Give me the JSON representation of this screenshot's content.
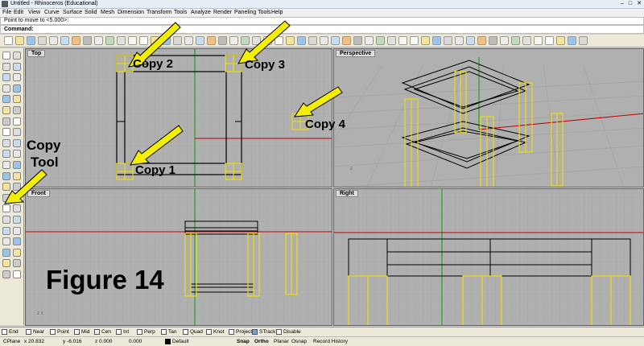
{
  "window": {
    "title": "Untitled - Rhinoceros (Educational)",
    "min": "–",
    "max": "□",
    "close": "✕"
  },
  "menu": [
    "File",
    "Edit",
    "View",
    "Curve",
    "Surface",
    "Solid",
    "Mesh",
    "Dimension",
    "Transform",
    "Tools",
    "Analyze",
    "Render",
    "Paneling Tools",
    "Help"
  ],
  "command_history": "Point to move to <5.000>:",
  "command_prompt": "Command:",
  "viewports": {
    "top": "Top",
    "perspective": "Perspective",
    "front": "Front",
    "right": "Right"
  },
  "annotations": {
    "copy1": "Copy 1",
    "copy2": "Copy 2",
    "copy3": "Copy 3",
    "copy4": "Copy 4",
    "tool_line1": "Copy",
    "tool_line2": "Tool",
    "figure": "Figure 14"
  },
  "osnaps": [
    "End",
    "Near",
    "Point",
    "Mid",
    "Cen",
    "Int",
    "Perp",
    "Tan",
    "Quad",
    "Knot",
    "Project",
    "STrack",
    "Disable"
  ],
  "status": {
    "cplane": "CPlane",
    "x": "x 20.832",
    "y": "y -6.016",
    "z": "z 0.000",
    "val": "0.000",
    "layer": "Default",
    "toggles": [
      "Snap",
      "Ortho",
      "Planar",
      "Osnap",
      "Record History"
    ]
  },
  "colors": {
    "arrow": "#f4ee00",
    "highlight": "#f0e000",
    "axis_x": "#c00000",
    "axis_y": "#00a000"
  }
}
